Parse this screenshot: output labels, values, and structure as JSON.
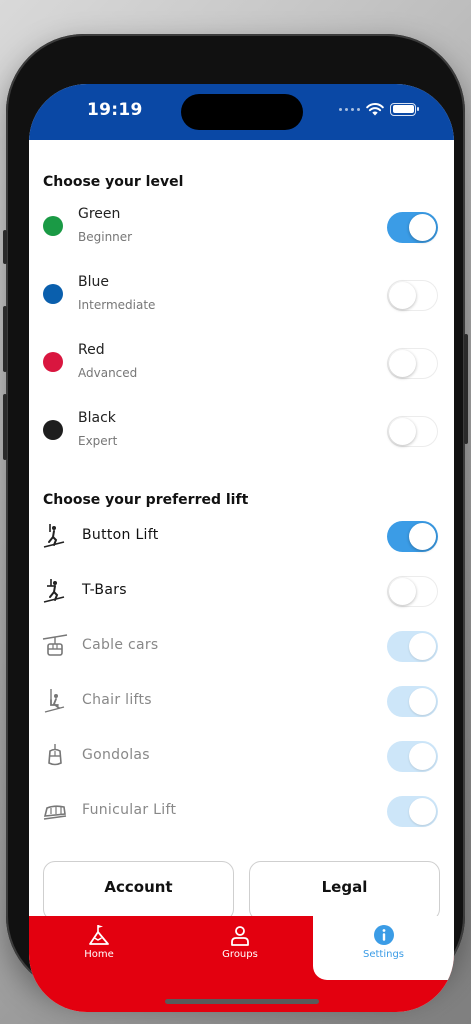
{
  "status_bar": {
    "time": "19:19"
  },
  "levels": {
    "title": "Choose your level",
    "items": [
      {
        "name": "Green",
        "subtitle": "Beginner",
        "color": "#1a9a45",
        "enabled": true
      },
      {
        "name": "Blue",
        "subtitle": "Intermediate",
        "color": "#0a5fad",
        "enabled": false
      },
      {
        "name": "Red",
        "subtitle": "Advanced",
        "color": "#d9163f",
        "enabled": false
      },
      {
        "name": "Black",
        "subtitle": "Expert",
        "color": "#1e1e1e",
        "enabled": false
      }
    ]
  },
  "lifts": {
    "title": "Choose your preferred lift",
    "items": [
      {
        "name": "Button Lift",
        "icon": "button-lift-icon",
        "state": "on"
      },
      {
        "name": "T-Bars",
        "icon": "t-bar-icon",
        "state": "off"
      },
      {
        "name": "Cable cars",
        "icon": "cable-car-icon",
        "state": "disabled-on"
      },
      {
        "name": "Chair lifts",
        "icon": "chair-lift-icon",
        "state": "disabled-on"
      },
      {
        "name": "Gondolas",
        "icon": "gondola-icon",
        "state": "disabled-on"
      },
      {
        "name": "Funicular Lift",
        "icon": "funicular-icon",
        "state": "disabled-on"
      }
    ]
  },
  "actions": {
    "account_label": "Account",
    "legal_label": "Legal"
  },
  "tabbar": {
    "items": [
      {
        "label": "Home",
        "icon": "mountain-flag-icon",
        "active": false
      },
      {
        "label": "Groups",
        "icon": "person-icon",
        "active": false
      },
      {
        "label": "Settings",
        "icon": "info-icon",
        "active": true
      }
    ]
  },
  "colors": {
    "brand_blue": "#0a48a5",
    "brand_red": "#e3000f",
    "toggle_on": "#3b9ce6",
    "toggle_disabled": "#cde6f9"
  }
}
